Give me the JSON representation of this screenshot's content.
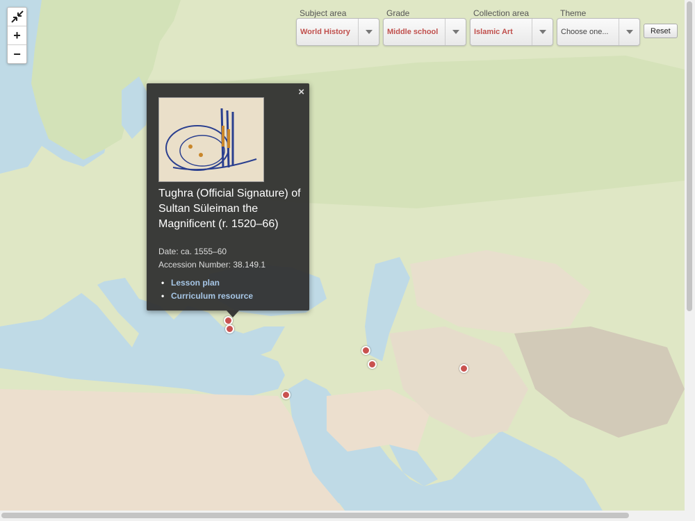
{
  "zoom_controls": {
    "fullscreen_icon": "collapse-arrows-icon",
    "zoom_in": "+",
    "zoom_out": "−"
  },
  "filters": [
    {
      "label": "Subject area",
      "value": "World History"
    },
    {
      "label": "Grade",
      "value": "Middle school"
    },
    {
      "label": "Collection area",
      "value": "Islamic Art"
    },
    {
      "label": "Theme",
      "value": "Choose one..."
    }
  ],
  "reset_label": "Reset",
  "popup": {
    "close": "×",
    "title": "Tughra (Official Signature) of Sultan Süleiman the Magnificent (r. 1520–66)",
    "date": "Date: ca. 1555–60",
    "accession": "Accession Number: 38.149.1",
    "links": [
      "Lesson plan",
      "Curriculum resource"
    ],
    "image": "tughra-calligraphy-thumbnail"
  },
  "colors": {
    "accent": "#c0504d",
    "marker": "#c9524f",
    "link": "#a7c7e7",
    "popup_bg": "#303030"
  }
}
